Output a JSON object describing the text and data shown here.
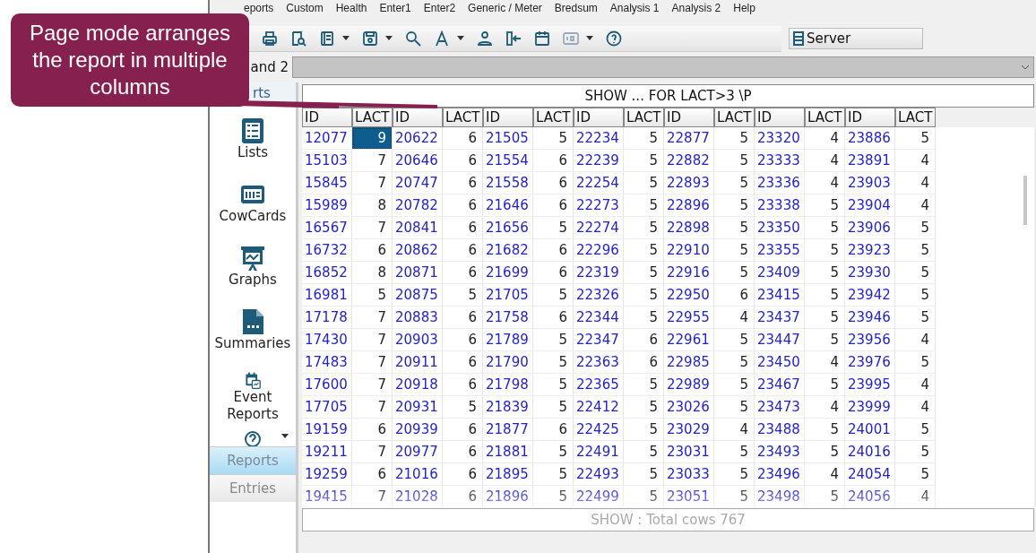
{
  "callout": {
    "text": "Page mode arranges the report in multiple columns"
  },
  "menu": [
    "eports",
    "Custom",
    "Health",
    "Enter1",
    "Enter2",
    "Generic / Meter",
    "Bredsum",
    "Analysis 1",
    "Analysis 2",
    "Help"
  ],
  "toolbar": {
    "server_button": "Server"
  },
  "combo": {
    "label": "and 2"
  },
  "sidebar": {
    "header": "rts",
    "items": [
      {
        "kind": "lists",
        "label": "Lists"
      },
      {
        "kind": "cards",
        "label": "CowCards"
      },
      {
        "kind": "graphs",
        "label": "Graphs"
      },
      {
        "kind": "summaries",
        "label": "Summaries"
      },
      {
        "kind": "events",
        "label": "Event Reports"
      },
      {
        "kind": "help"
      }
    ],
    "tabs": [
      {
        "label": "Reports",
        "selected": true
      },
      {
        "label": "Entries",
        "selected": false
      }
    ]
  },
  "report": {
    "title": "SHOW ...  FOR LACT>3 \\P",
    "columns": [
      "ID",
      "LACT",
      "ID",
      "LACT",
      "ID",
      "LACT",
      "ID",
      "LACT",
      "ID",
      "LACT",
      "ID",
      "LACT",
      "ID",
      "LACT"
    ],
    "rows": [
      {
        "cells": [
          "12077",
          "9",
          "20622",
          "6",
          "21505",
          "5",
          "22234",
          "5",
          "22877",
          "5",
          "23320",
          "4",
          "23886",
          "5"
        ],
        "selected": [
          false,
          true,
          false,
          false,
          false,
          false,
          false,
          false,
          false,
          false,
          false,
          false,
          false,
          false
        ]
      },
      {
        "cells": [
          "15103",
          "7",
          "20646",
          "6",
          "21554",
          "6",
          "22239",
          "5",
          "22882",
          "5",
          "23333",
          "4",
          "23891",
          "4"
        ],
        "selected": [
          false,
          false,
          false,
          false,
          false,
          false,
          false,
          false,
          false,
          false,
          false,
          false,
          false,
          false
        ]
      },
      {
        "cells": [
          "15845",
          "7",
          "20747",
          "6",
          "21558",
          "6",
          "22254",
          "5",
          "22893",
          "5",
          "23336",
          "4",
          "23903",
          "4"
        ],
        "selected": [
          false,
          false,
          false,
          false,
          false,
          false,
          false,
          false,
          false,
          false,
          false,
          false,
          false,
          false
        ]
      },
      {
        "cells": [
          "15989",
          "8",
          "20782",
          "6",
          "21646",
          "6",
          "22273",
          "5",
          "22896",
          "5",
          "23338",
          "5",
          "23904",
          "4"
        ],
        "selected": [
          false,
          false,
          false,
          false,
          false,
          false,
          false,
          false,
          false,
          false,
          false,
          false,
          false,
          false
        ]
      },
      {
        "cells": [
          "16567",
          "7",
          "20841",
          "6",
          "21656",
          "5",
          "22274",
          "5",
          "22898",
          "5",
          "23350",
          "5",
          "23906",
          "5"
        ],
        "selected": [
          false,
          false,
          false,
          false,
          false,
          false,
          false,
          false,
          false,
          false,
          false,
          false,
          false,
          false
        ]
      },
      {
        "cells": [
          "16732",
          "6",
          "20862",
          "6",
          "21682",
          "6",
          "22296",
          "5",
          "22910",
          "5",
          "23355",
          "5",
          "23923",
          "5"
        ],
        "selected": [
          false,
          false,
          false,
          false,
          false,
          false,
          false,
          false,
          false,
          false,
          false,
          false,
          false,
          false
        ]
      },
      {
        "cells": [
          "16852",
          "8",
          "20871",
          "6",
          "21699",
          "6",
          "22319",
          "5",
          "22916",
          "5",
          "23409",
          "5",
          "23930",
          "5"
        ],
        "selected": [
          false,
          false,
          false,
          false,
          false,
          false,
          false,
          false,
          false,
          false,
          false,
          false,
          false,
          false
        ]
      },
      {
        "cells": [
          "16981",
          "5",
          "20875",
          "5",
          "21705",
          "5",
          "22326",
          "5",
          "22950",
          "6",
          "23415",
          "5",
          "23942",
          "5"
        ],
        "selected": [
          false,
          false,
          false,
          false,
          false,
          false,
          false,
          false,
          false,
          false,
          false,
          false,
          false,
          false
        ]
      },
      {
        "cells": [
          "17178",
          "7",
          "20883",
          "6",
          "21758",
          "6",
          "22344",
          "5",
          "22955",
          "4",
          "23437",
          "5",
          "23946",
          "5"
        ],
        "selected": [
          false,
          false,
          false,
          false,
          false,
          false,
          false,
          false,
          false,
          false,
          false,
          false,
          false,
          false
        ]
      },
      {
        "cells": [
          "17430",
          "7",
          "20903",
          "6",
          "21789",
          "5",
          "22347",
          "6",
          "22961",
          "5",
          "23447",
          "5",
          "23956",
          "4"
        ],
        "selected": [
          false,
          false,
          false,
          false,
          false,
          false,
          false,
          false,
          false,
          false,
          false,
          false,
          false,
          false
        ]
      },
      {
        "cells": [
          "17483",
          "7",
          "20911",
          "6",
          "21790",
          "5",
          "22363",
          "6",
          "22985",
          "5",
          "23450",
          "4",
          "23976",
          "5"
        ],
        "selected": [
          false,
          false,
          false,
          false,
          false,
          false,
          false,
          false,
          false,
          false,
          false,
          false,
          false,
          false
        ]
      },
      {
        "cells": [
          "17600",
          "7",
          "20918",
          "6",
          "21798",
          "5",
          "22365",
          "5",
          "22989",
          "5",
          "23467",
          "5",
          "23995",
          "4"
        ],
        "selected": [
          false,
          false,
          false,
          false,
          false,
          false,
          false,
          false,
          false,
          false,
          false,
          false,
          false,
          false
        ]
      },
      {
        "cells": [
          "17705",
          "7",
          "20931",
          "5",
          "21839",
          "5",
          "22412",
          "5",
          "23026",
          "5",
          "23473",
          "4",
          "23999",
          "4"
        ],
        "selected": [
          false,
          false,
          false,
          false,
          false,
          false,
          false,
          false,
          false,
          false,
          false,
          false,
          false,
          false
        ]
      },
      {
        "cells": [
          "19159",
          "6",
          "20939",
          "6",
          "21877",
          "6",
          "22425",
          "5",
          "23029",
          "4",
          "23488",
          "5",
          "24001",
          "5"
        ],
        "selected": [
          false,
          false,
          false,
          false,
          false,
          false,
          false,
          false,
          false,
          false,
          false,
          false,
          false,
          false
        ]
      },
      {
        "cells": [
          "19211",
          "7",
          "20977",
          "6",
          "21881",
          "5",
          "22491",
          "5",
          "23031",
          "5",
          "23493",
          "5",
          "24016",
          "5"
        ],
        "selected": [
          false,
          false,
          false,
          false,
          false,
          false,
          false,
          false,
          false,
          false,
          false,
          false,
          false,
          false
        ]
      },
      {
        "cells": [
          "19259",
          "6",
          "21016",
          "6",
          "21895",
          "5",
          "22493",
          "5",
          "23033",
          "5",
          "23496",
          "4",
          "24054",
          "5"
        ],
        "selected": [
          false,
          false,
          false,
          false,
          false,
          false,
          false,
          false,
          false,
          false,
          false,
          false,
          false,
          false
        ]
      },
      {
        "cells": [
          "19415",
          "7",
          "21028",
          "6",
          "21896",
          "5",
          "22499",
          "5",
          "23051",
          "5",
          "23498",
          "5",
          "24056",
          "4"
        ],
        "selected": [
          false,
          false,
          false,
          false,
          false,
          false,
          false,
          false,
          false,
          false,
          false,
          false,
          false,
          false
        ]
      }
    ],
    "footer": "SHOW : Total cows  767"
  }
}
